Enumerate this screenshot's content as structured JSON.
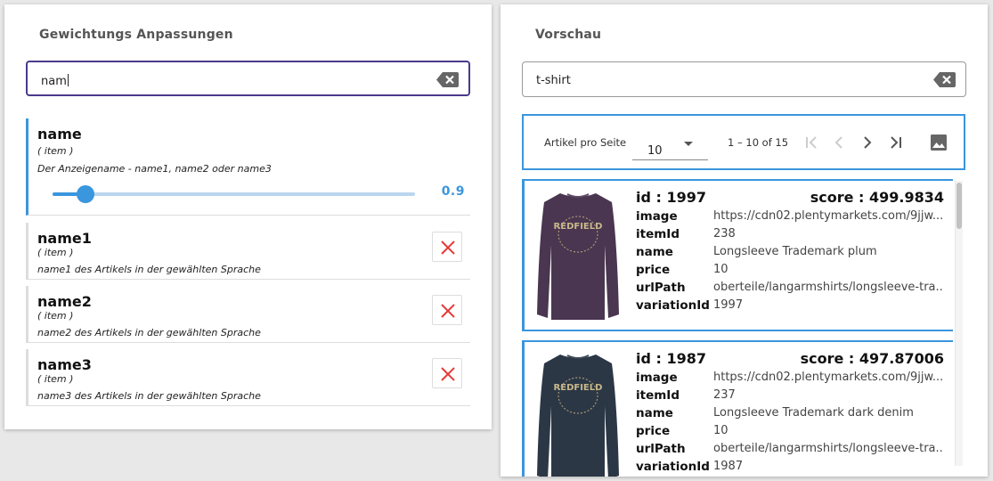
{
  "weights": {
    "title": "Gewichtungs Anpassungen",
    "search": {
      "value": "nam"
    },
    "items": [
      {
        "name": "name",
        "type": "( item )",
        "description": "Der Anzeigename - name1, name2 oder name3",
        "value": "0.9",
        "level": 0.09
      },
      {
        "name": "name1",
        "type": "( item )",
        "description": "name1 des Artikels in der gewählten Sprache"
      },
      {
        "name": "name2",
        "type": "( item )",
        "description": "name2 des Artikels in der gewählten Sprache"
      },
      {
        "name": "name3",
        "type": "( item )",
        "description": "name3 des Artikels in der gewählten Sprache"
      }
    ]
  },
  "preview": {
    "title": "Vorschau",
    "search": {
      "value": "t-shirt"
    },
    "paginator": {
      "items_per_page_label": "Artikel pro Seite",
      "items_per_page_value": "10",
      "range": "1 – 10 of 15"
    },
    "results": [
      {
        "id_label": "id : 1997",
        "score_label": "score : 499.9834",
        "shirt_color": "#4a3650",
        "print_text": "REDFIELD",
        "fields": [
          {
            "key": "image",
            "value": "https://cdn02.plentymarkets.com/9jjw..."
          },
          {
            "key": "itemId",
            "value": "238"
          },
          {
            "key": "name",
            "value": "Longsleeve Trademark plum"
          },
          {
            "key": "price",
            "value": "10"
          },
          {
            "key": "urlPath",
            "value": "oberteile/langarmshirts/longsleeve-tra..."
          },
          {
            "key": "variationId",
            "value": "1997"
          }
        ]
      },
      {
        "id_label": "id : 1987",
        "score_label": "score : 497.87006",
        "shirt_color": "#2c3746",
        "print_text": "REDFIELD",
        "fields": [
          {
            "key": "image",
            "value": "https://cdn02.plentymarkets.com/9jjw..."
          },
          {
            "key": "itemId",
            "value": "237"
          },
          {
            "key": "name",
            "value": "Longsleeve Trademark dark denim"
          },
          {
            "key": "price",
            "value": "10"
          },
          {
            "key": "urlPath",
            "value": "oberteile/langarmshirts/longsleeve-tra..."
          },
          {
            "key": "variationId",
            "value": "1987"
          }
        ]
      }
    ]
  },
  "colors": {
    "accent": "#3a96dd",
    "focus_border": "#4a3a8c",
    "remove_red": "#e53935"
  },
  "icons": [
    "backspace-clear-icon",
    "close-icon",
    "chevron-down-icon",
    "first-page-icon",
    "chevron-left-icon",
    "chevron-right-icon",
    "last-page-icon",
    "image-icon"
  ]
}
